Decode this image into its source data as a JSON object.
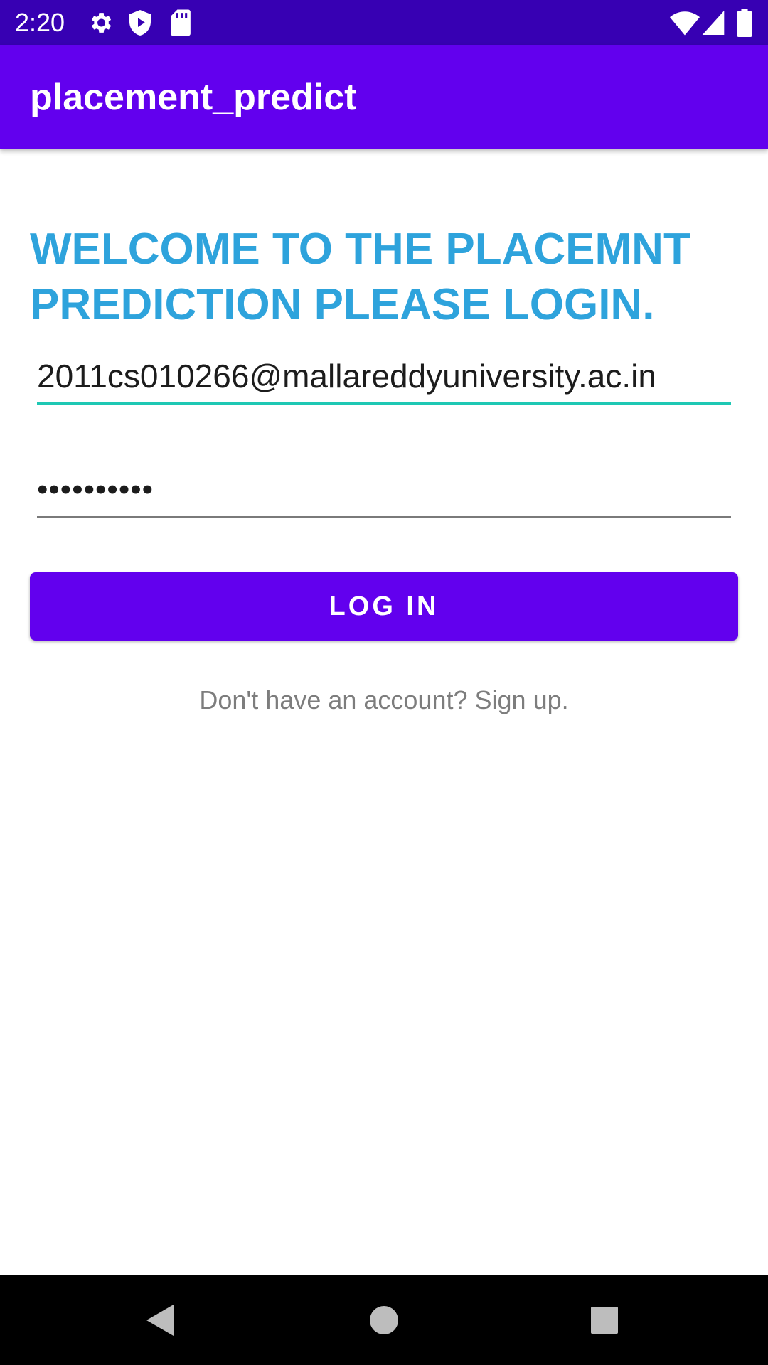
{
  "status_bar": {
    "time": "2:20",
    "left_icons": [
      "gear-icon",
      "shield-icon",
      "sd-card-icon"
    ],
    "right_icons": [
      "wifi-icon",
      "cell-signal-icon",
      "battery-icon"
    ]
  },
  "app_bar": {
    "title": "placement_predict"
  },
  "login": {
    "heading": "WELCOME TO THE PLACEMNT PREDICTION PLEASE LOGIN.",
    "email_value": "2011cs010266@mallareddyuniversity.ac.in",
    "password_value": "••••••••••",
    "login_button_label": "LOG IN",
    "signup_link": "Don't have an account? Sign up."
  },
  "nav_bar": {
    "buttons": [
      "back-icon",
      "home-icon",
      "recents-icon"
    ]
  },
  "colors": {
    "status_bar": "#3700b3",
    "primary": "#6200ee",
    "heading": "#2ea3dc",
    "focus_underline": "#1ec8b4",
    "link_text": "#7d7d7d"
  }
}
